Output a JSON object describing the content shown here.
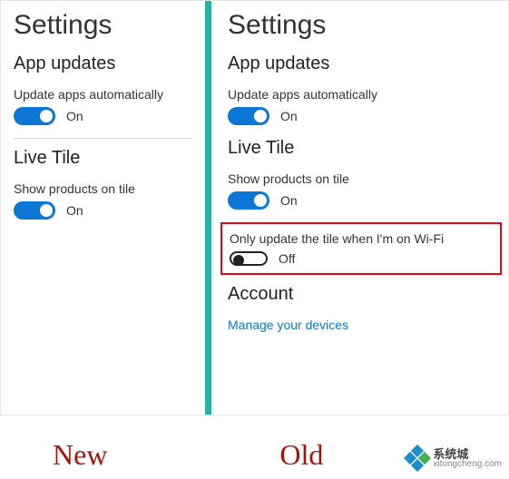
{
  "left": {
    "title": "Settings",
    "sections": {
      "app_updates": {
        "heading": "App updates",
        "update_auto": {
          "label": "Update apps automatically",
          "state": "On",
          "on": true
        }
      },
      "live_tile": {
        "heading": "Live Tile",
        "show_products": {
          "label": "Show products on tile",
          "state": "On",
          "on": true
        }
      }
    }
  },
  "right": {
    "title": "Settings",
    "sections": {
      "app_updates": {
        "heading": "App updates",
        "update_auto": {
          "label": "Update apps automatically",
          "state": "On",
          "on": true
        }
      },
      "live_tile": {
        "heading": "Live Tile",
        "show_products": {
          "label": "Show products on tile",
          "state": "On",
          "on": true
        },
        "wifi_only": {
          "label": "Only update the tile when I'm on Wi-Fi",
          "state": "Off",
          "on": false
        }
      },
      "account": {
        "heading": "Account",
        "manage_link": "Manage your devices"
      }
    }
  },
  "footer": {
    "new": "New",
    "old": "Old"
  },
  "watermark": {
    "name": "系统城",
    "url": "xitongcheng.com"
  }
}
